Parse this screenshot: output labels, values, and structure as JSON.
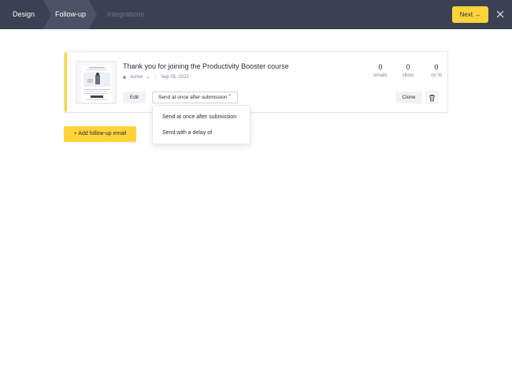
{
  "topbar": {
    "steps": [
      {
        "label": "Design"
      },
      {
        "label": "Follow-up"
      },
      {
        "label": "Integrations"
      }
    ],
    "next_label": "Next →",
    "colors": {
      "background": "#3a4152",
      "active_step": "#ffffff",
      "inactive_step": "#6b7385",
      "accent": "#ffd43b"
    }
  },
  "followup": {
    "title": "Thank you for joining the Productivity Booster course",
    "status": "Active",
    "date": "Sep 05, 2022",
    "stats": [
      {
        "value": "0",
        "label": "emails"
      },
      {
        "value": "0",
        "label": "clicks"
      },
      {
        "value": "0",
        "label": "ctr %"
      }
    ],
    "edit_label": "Edit",
    "send_select": {
      "selected": "Send at once after submission"
    },
    "clone_label": "Clone",
    "icons": {
      "status": "status-dot-icon",
      "delete": "trash-icon"
    }
  },
  "dropdown": {
    "options": [
      {
        "label": "Send at once after submission"
      },
      {
        "label": "Send with a delay of"
      }
    ]
  },
  "add_button_label": "+ Add follow-up email"
}
